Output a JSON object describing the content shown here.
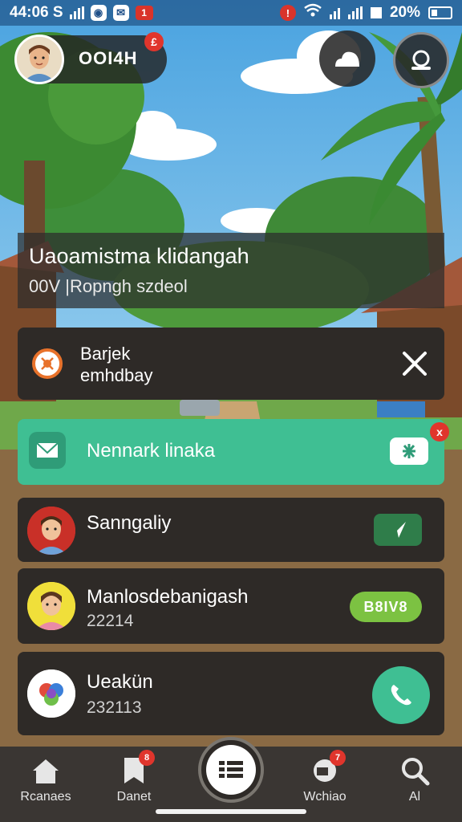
{
  "status_bar": {
    "time": "44:06 S",
    "battery_text": "20%",
    "notification_badge": "1"
  },
  "profile": {
    "name": "OOI4H",
    "badge_count": "£"
  },
  "title_banner": {
    "title": "Uaoamistma klidangah",
    "subtitle": "00V |Ropngh szdeol"
  },
  "info_card": {
    "line1": "Barjek",
    "line2": "emhdbay"
  },
  "green_card": {
    "label": "Nennark linaka",
    "badge": "x"
  },
  "contacts": [
    {
      "name": "Sanngaliy",
      "sub": ""
    },
    {
      "name": "Manlosdebanigash",
      "sub": "22214",
      "button": "B8IV8"
    },
    {
      "name": "Ueakün",
      "sub": "232113"
    }
  ],
  "bottom_nav": {
    "items": [
      {
        "label": "Rcanaes"
      },
      {
        "label": "Danet",
        "badge": "8"
      },
      {
        "label": "Wchiao",
        "badge": "7"
      },
      {
        "label": "Al"
      }
    ]
  },
  "colors": {
    "accent_green": "#3fbf93",
    "card_dark": "#2e2a27",
    "badge_red": "#e0352c",
    "pill_green": "#7cc242"
  }
}
